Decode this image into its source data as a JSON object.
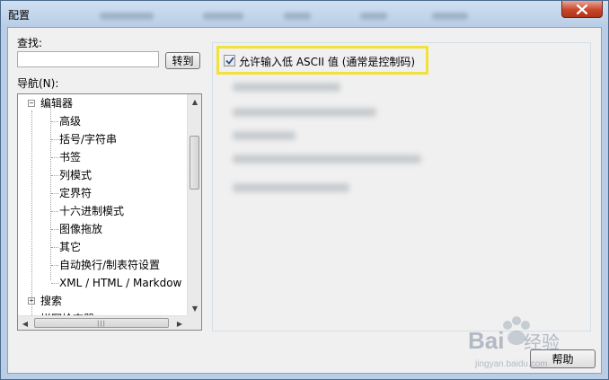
{
  "window": {
    "title": "配置"
  },
  "find": {
    "label": "查找:",
    "value": "",
    "goto_label": "转到"
  },
  "nav": {
    "label": "导航(N):",
    "tree": [
      {
        "label": "编辑器",
        "level": 0,
        "expander": "−"
      },
      {
        "label": "高级",
        "level": 1
      },
      {
        "label": "括号/字符串",
        "level": 1
      },
      {
        "label": "书签",
        "level": 1
      },
      {
        "label": "列模式",
        "level": 1
      },
      {
        "label": "定界符",
        "level": 1
      },
      {
        "label": "十六进制模式",
        "level": 1
      },
      {
        "label": "图像拖放",
        "level": 1
      },
      {
        "label": "其它",
        "level": 1
      },
      {
        "label": "自动换行/制表符设置",
        "level": 1
      },
      {
        "label": "XML / HTML / Markdow",
        "level": 1
      },
      {
        "label": "搜索",
        "level": 0,
        "expander": "+"
      },
      {
        "label": "拼写检查器",
        "level": 0,
        "expander": "+"
      }
    ]
  },
  "options": {
    "low_ascii": {
      "label": "允许输入低 ASCII 值 (通常是控制码)",
      "checked": true
    }
  },
  "buttons": {
    "help": "帮助"
  },
  "watermark": {
    "brand": "Bai",
    "brand2": "经验",
    "url": "jingyan.baidu.com"
  },
  "colors": {
    "highlight": "#f1e13b",
    "close": "#c9462c"
  }
}
